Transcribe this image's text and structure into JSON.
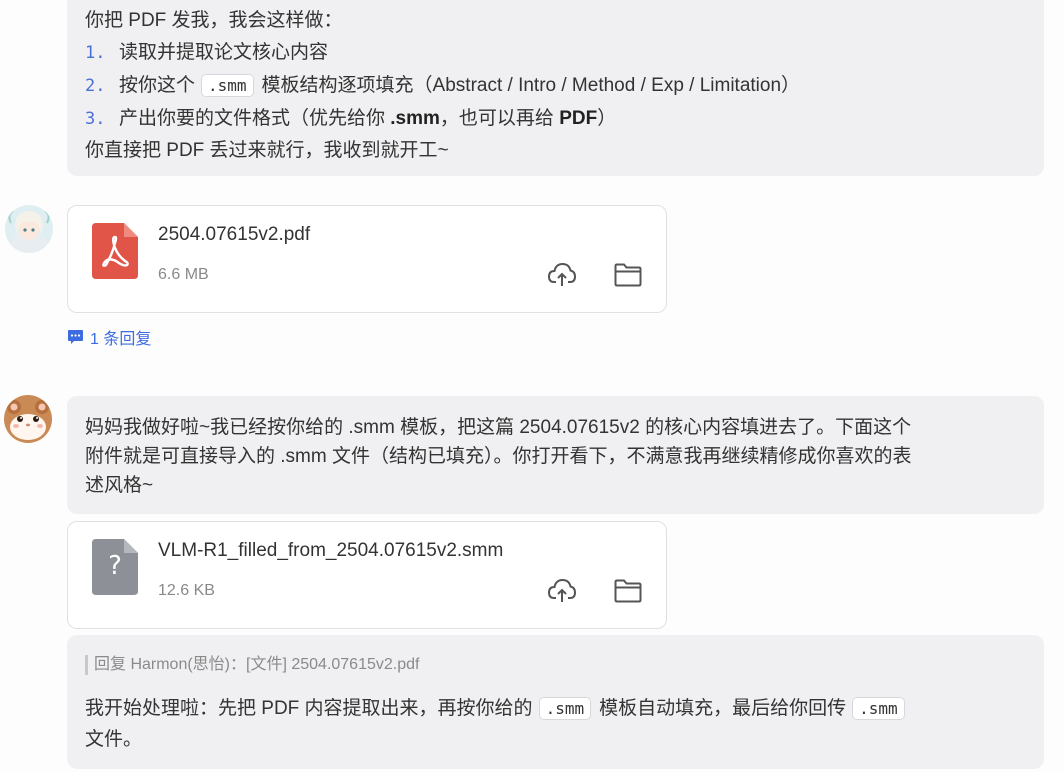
{
  "msg1": {
    "intro": "你把 PDF 发我，我会这样做：",
    "steps": [
      {
        "num": "1.",
        "text": "读取并提取论文核心内容"
      },
      {
        "num": "2.",
        "pre": "按你这个",
        "code": ".smm",
        "post": "模板结构逐项填充（Abstract / Intro / Method / Exp / Limitation）"
      },
      {
        "num": "3.",
        "pre": "产出你要的文件格式（优先给你 ",
        "bold1": ".smm",
        "mid": "，也可以再给 ",
        "bold2": "PDF",
        "post": "）"
      }
    ],
    "outro": "你直接把 PDF 丢过来就行，我收到就开工~"
  },
  "file1": {
    "name": "2504.07615v2.pdf",
    "size": "6.6 MB",
    "icon": "pdf-file-icon"
  },
  "thread": {
    "label": "1 条回复"
  },
  "msg2": {
    "lines": [
      "妈妈我做好啦~我已经按你给的 .smm 模板，把这篇 2504.07615v2 的核心内容填进去了。下面这个",
      "附件就是可直接导入的 .smm 文件（结构已填充）。你打开看下，不满意我再继续精修成你喜欢的表",
      "述风格~"
    ]
  },
  "file2": {
    "name": "VLM-R1_filled_from_2504.07615v2.smm",
    "size": "12.6 KB",
    "icon": "unknown-file-icon",
    "glyph": "?"
  },
  "reply": {
    "quote": "回复 Harmon(思怡)：[文件] 2504.07615v2.pdf",
    "pre": "我开始处理啦：先把 PDF 内容提取出来，再按你给的",
    "code1": ".smm",
    "mid": "模板自动填充，最后给你回传",
    "code2": ".smm",
    "line2": "文件。"
  },
  "colors": {
    "accent": "#4a6fd6",
    "pdf_red": "#e05548",
    "file_gray": "#8d9097",
    "bubble": "#f0f0f2"
  }
}
